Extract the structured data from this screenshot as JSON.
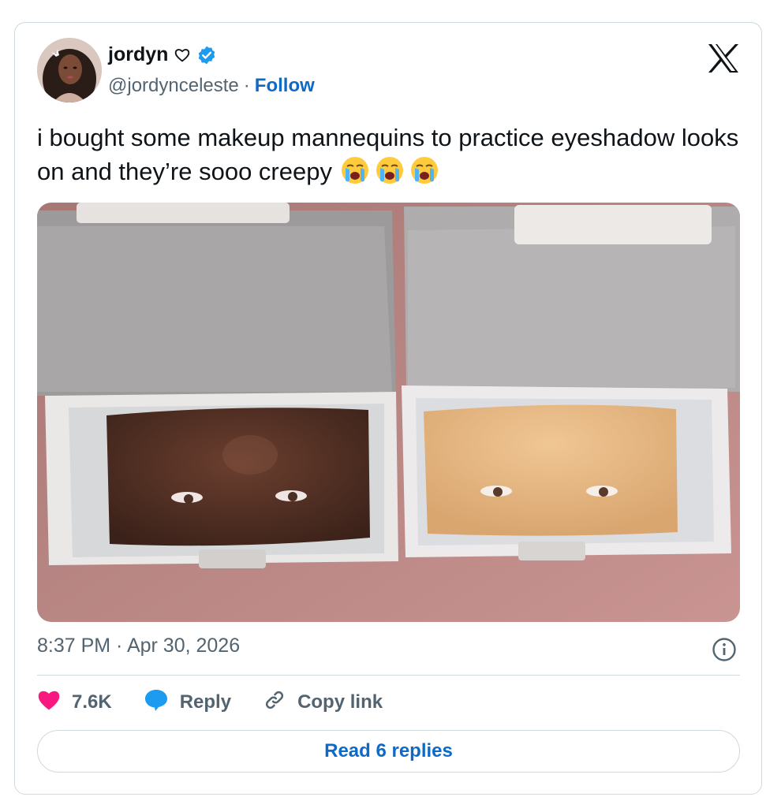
{
  "author": {
    "display_name": "jordyn",
    "handle": "@jordynceleste",
    "separator": "·",
    "follow_label": "Follow"
  },
  "tweet": {
    "text": "i bought some makeup mannequins to practice eyeshadow looks on and they’re sooo creepy",
    "emoji_icon": "loudly-crying-face-icon",
    "emoji_count": 3
  },
  "timestamp": "8:37 PM · Apr 30, 2026",
  "actions": {
    "likes": "7.6K",
    "reply_label": "Reply",
    "copy_label": "Copy link"
  },
  "read_replies_label": "Read 6 replies",
  "colors": {
    "link_blue": "#0e6ac6",
    "verified_blue": "#1d9bf0",
    "like_pink": "#f91880",
    "reply_blue": "#1d9bf0",
    "muted": "#536471",
    "border": "#cfd9de"
  }
}
